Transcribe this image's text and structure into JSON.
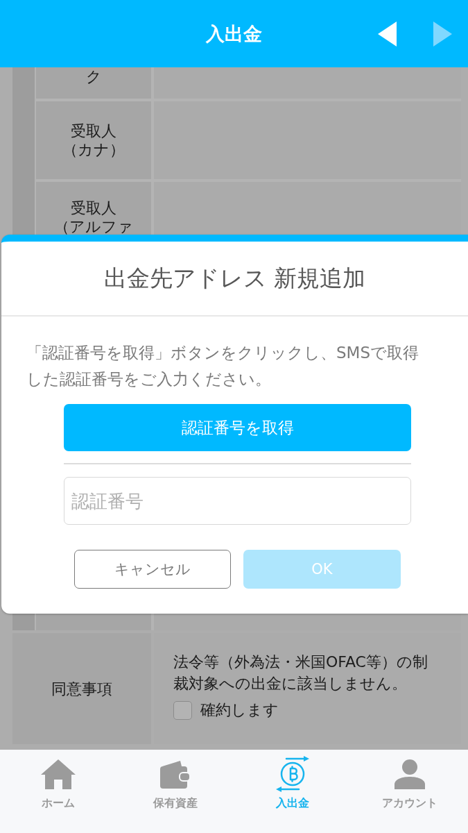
{
  "header": {
    "title": "入出金",
    "prev_button": {
      "disabled": false
    },
    "next_button": {
      "disabled": true
    }
  },
  "form_table": {
    "group_rows": [
      {
        "label_lines": [
          "ク"
        ]
      },
      {
        "label_lines": [
          "受取人",
          "（カナ）"
        ]
      },
      {
        "label_lines": [
          "受取人",
          "（アルファ"
        ]
      }
    ],
    "agreement_row": {
      "label_lines": [
        "同意事項"
      ],
      "text": "法令等（外為法・米国OFAC等）の制裁対象への出金に該当しません。",
      "checkbox": {
        "label": "確約します",
        "checked": false
      }
    }
  },
  "dialog": {
    "title": "出金先アドレス 新規追加",
    "message": "「認証番号を取得」ボタンをクリックし、SMSで取得した認証番号をご入力ください。",
    "get_code_button": "認証番号を取得",
    "code_field": {
      "placeholder": "認証番号"
    },
    "cancel_button": "キャンセル",
    "ok_button": {
      "label": "OK",
      "disabled": true
    }
  },
  "tab_bar": {
    "tabs": [
      {
        "kind": "home",
        "label": "ホーム",
        "selected": false
      },
      {
        "kind": "wallet",
        "label": "保有資産",
        "selected": false
      },
      {
        "kind": "transfer",
        "label": "入出金",
        "selected": true
      },
      {
        "kind": "account",
        "label": "アカウント",
        "selected": false
      }
    ]
  }
}
